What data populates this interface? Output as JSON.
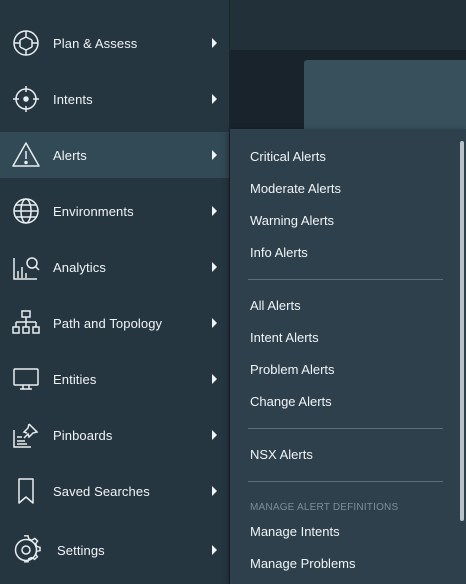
{
  "nav": {
    "items": [
      {
        "label": "Plan & Assess",
        "icon": "plan-assess-icon"
      },
      {
        "label": "Intents",
        "icon": "crosshair-icon"
      },
      {
        "label": "Alerts",
        "icon": "warning-triangle-icon"
      },
      {
        "label": "Environments",
        "icon": "globe-icon"
      },
      {
        "label": "Analytics",
        "icon": "analytics-chart-icon"
      },
      {
        "label": "Path and Topology",
        "icon": "topology-tree-icon"
      },
      {
        "label": "Entities",
        "icon": "monitor-icon"
      },
      {
        "label": "Pinboards",
        "icon": "pinboard-icon"
      },
      {
        "label": "Saved Searches",
        "icon": "bookmark-icon"
      },
      {
        "label": "Settings",
        "icon": "gear-icon"
      }
    ],
    "active": "Alerts"
  },
  "alerts_menu": {
    "group1": [
      "Critical Alerts",
      "Moderate Alerts",
      "Warning Alerts",
      "Info Alerts"
    ],
    "group2": [
      "All Alerts",
      "Intent Alerts",
      "Problem Alerts",
      "Change Alerts"
    ],
    "group3": [
      "NSX Alerts"
    ],
    "section_header": "MANAGE ALERT DEFINITIONS",
    "group4": [
      "Manage Intents",
      "Manage Problems"
    ]
  },
  "colors": {
    "nav_bg": "#263641",
    "nav_active": "#324956",
    "submenu_bg": "#2d404c",
    "text": "#f1f4f6"
  }
}
